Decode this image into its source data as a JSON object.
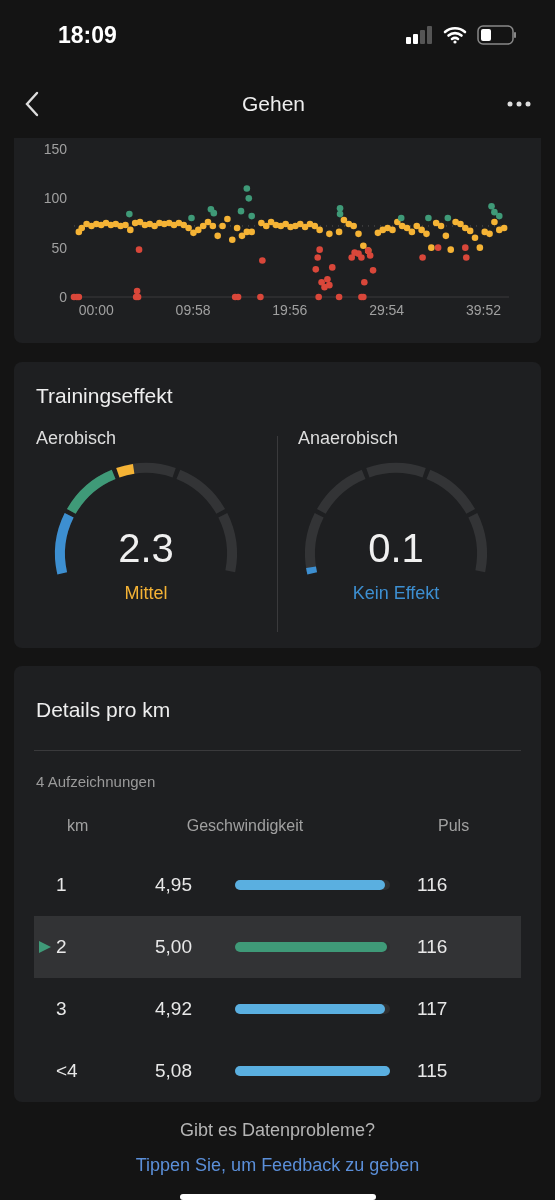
{
  "status_bar": {
    "time": "18:09"
  },
  "nav": {
    "title": "Gehen"
  },
  "heart_rate_chart": {
    "chart_data": {
      "type": "scatter",
      "xlim": [
        -2.3,
        42.5
      ],
      "ref_lines": [
        {
          "axis": "y",
          "value": 72
        }
      ],
      "ylim": [
        0,
        150
      ],
      "yticks": [
        0,
        50,
        100,
        150
      ],
      "xticks": [
        {
          "value": 0,
          "label": "00:00"
        },
        {
          "value": 9.97,
          "label": "09:58"
        },
        {
          "value": 19.93,
          "label": "19:56"
        },
        {
          "value": 29.9,
          "label": "29:54"
        },
        {
          "value": 39.87,
          "label": "39:52"
        }
      ],
      "series": [
        {
          "color": "#f5b335",
          "x": [
            -1.8,
            -1.5,
            -1,
            -0.5,
            0,
            0.5,
            1,
            1.5,
            2,
            2.5,
            3,
            3.5,
            4,
            4.5,
            5,
            5.5,
            6,
            6.5,
            7,
            7.5,
            8,
            8.5,
            9,
            9.5,
            10,
            10.5,
            11,
            11.5,
            12,
            12.5,
            13,
            13.5,
            14,
            14.5,
            15,
            15.5,
            16,
            17,
            17.5,
            18,
            18.5,
            19,
            19.5,
            20,
            20.5,
            21,
            21.5,
            22,
            22.5,
            23,
            24,
            25,
            25.5,
            26,
            26.5,
            27,
            27.5,
            28,
            29,
            29.5,
            30,
            30.5,
            31,
            31.5,
            32,
            32.5,
            33,
            33.5,
            34,
            34.5,
            35,
            35.5,
            36,
            36.5,
            37,
            37.5,
            38,
            38.5,
            39,
            39.5,
            40,
            40.5,
            41,
            41.5,
            42
          ],
          "values": [
            66,
            70,
            74,
            72,
            74,
            73,
            75,
            73,
            74,
            72,
            73,
            68,
            75,
            76,
            73,
            74,
            72,
            75,
            74,
            75,
            73,
            75,
            73,
            70,
            65,
            68,
            72,
            76,
            72,
            62,
            72,
            79,
            58,
            70,
            62,
            66,
            66,
            75,
            72,
            76,
            73,
            72,
            74,
            71,
            72,
            74,
            71,
            74,
            72,
            68,
            64,
            66,
            78,
            74,
            72,
            64,
            52,
            47,
            65,
            68,
            70,
            68,
            76,
            72,
            70,
            66,
            72,
            68,
            64,
            50,
            75,
            72,
            62,
            48,
            76,
            74,
            70,
            67,
            60,
            50,
            66,
            64,
            76,
            68,
            70
          ]
        },
        {
          "color": "#3f9a78",
          "x": [
            3.4,
            9.8,
            11.8,
            12.1,
            14.9,
            15.5,
            15.7,
            16,
            25.1,
            25.1,
            31.4,
            34.2,
            36.2,
            40.7,
            41,
            41.5
          ],
          "values": [
            84,
            80,
            89,
            85,
            87,
            110,
            100,
            82,
            90,
            84,
            80,
            80,
            80,
            92,
            86,
            82
          ]
        },
        {
          "color": "#d9473a",
          "x": [
            -2.3,
            -2,
            -1.8,
            4.1,
            4.3,
            4.2,
            4.4,
            14.3,
            14.6,
            16.9,
            17.1,
            22.6,
            22.8,
            23,
            23.2,
            23.5,
            23.8,
            24,
            24.3,
            22.9,
            25,
            26.3,
            26.6,
            27,
            27.3,
            27.6,
            27.3,
            27.5,
            28,
            28.2,
            28.5,
            33.6,
            35.2,
            38,
            38.1
          ],
          "values": [
            0,
            0,
            0,
            0,
            0,
            6,
            48,
            0,
            0,
            0,
            37,
            28,
            40,
            48,
            15,
            10,
            18,
            12,
            30,
            0,
            0,
            40,
            45,
            44,
            40,
            15,
            0,
            0,
            47,
            42,
            27,
            40,
            50,
            50,
            40
          ]
        }
      ]
    }
  },
  "training": {
    "title": "Trainingseffekt",
    "gauges": [
      {
        "label": "Aerobisch",
        "value": "2.3",
        "status": "Mittel",
        "color": "#f5b335"
      },
      {
        "label": "Anaerobisch",
        "value": "0.1",
        "status": "Kein Effekt",
        "color": "#3d8fd1"
      }
    ]
  },
  "details": {
    "title": "Details pro km",
    "count": "4 Aufzeichnungen",
    "columns": [
      "km",
      "Geschwindigkeit",
      "Puls"
    ],
    "rows": [
      {
        "km": "1",
        "speed": "4,95",
        "level": 0.97,
        "pulse": "116",
        "selected": false
      },
      {
        "km": "2",
        "speed": "5,00",
        "level": 0.98,
        "pulse": "116",
        "selected": true
      },
      {
        "km": "3",
        "speed": "4,92",
        "level": 0.97,
        "pulse": "117",
        "selected": false
      },
      {
        "km": "<4",
        "speed": "5,08",
        "level": 1.0,
        "pulse": "115",
        "selected": false
      }
    ]
  },
  "footer": {
    "question": "Gibt es Datenprobleme?",
    "link": "Tippen Sie, um Feedback zu geben"
  }
}
